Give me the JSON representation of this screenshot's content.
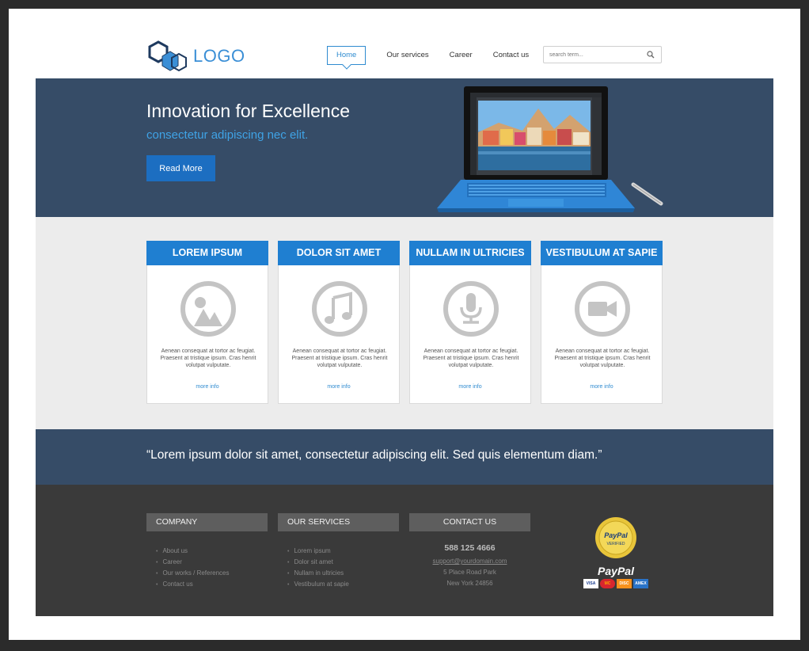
{
  "header": {
    "logo_text": "LOGO",
    "nav": [
      {
        "label": "Home",
        "active": true
      },
      {
        "label": "Our services",
        "active": false
      },
      {
        "label": "Career",
        "active": false
      },
      {
        "label": "Contact us",
        "active": false
      }
    ],
    "search_placeholder": "search term..."
  },
  "hero": {
    "title": "Innovation for Excellence",
    "subtitle": "consectetur adipiscing nec elit.",
    "button_label": "Read More"
  },
  "features": [
    {
      "title": "LOREM IPSUM",
      "icon": "image-icon",
      "text": "Aenean consequat at tortor ac feugiat. Praesent at tristique ipsum. Cras henrit volutpat vulputate.",
      "link": "more info"
    },
    {
      "title": "DOLOR SIT AMET",
      "icon": "music-icon",
      "text": "Aenean consequat at tortor ac feugiat. Praesent at tristique ipsum. Cras henrit volutpat vulputate.",
      "link": "more info"
    },
    {
      "title": "NULLAM IN ULTRICIES",
      "icon": "microphone-icon",
      "text": "Aenean consequat at tortor ac feugiat. Praesent at tristique ipsum. Cras henrit volutpat vulputate.",
      "link": "more info"
    },
    {
      "title": "VESTIBULUM AT SAPIE",
      "icon": "video-icon",
      "text": "Aenean consequat at tortor ac feugiat. Praesent at tristique ipsum. Cras henrit volutpat vulputate.",
      "link": "more info"
    }
  ],
  "quote": "“Lorem ipsum dolor sit amet, consectetur adipiscing elit. Sed quis elementum diam.”",
  "footer": {
    "company": {
      "title": "COMPANY",
      "items": [
        "About us",
        "Career",
        "Our works / References",
        "Contact us"
      ]
    },
    "services": {
      "title": "OUR SERVICES",
      "items": [
        "Lorem ipsum",
        "Dolor sit amet",
        "Nullam in ultricies",
        "Vestibulum at sapie"
      ]
    },
    "contact": {
      "title": "CONTACT US",
      "phone": "588 125 4666",
      "email": "support@yourdomain.com",
      "address1": "5 Place Road Park",
      "address2": "New York 24856"
    },
    "paypal": {
      "seal_top": "PayPal",
      "seal_bottom": "VERIFIED",
      "wordmark": "PayPal",
      "cards": [
        "VISA",
        "MC",
        "DISC",
        "AMEX"
      ]
    }
  },
  "colors": {
    "accent": "#1f7fd1",
    "hero_bg": "#364c67",
    "footer_bg": "#3a3a3a",
    "features_bg": "#ececec"
  }
}
